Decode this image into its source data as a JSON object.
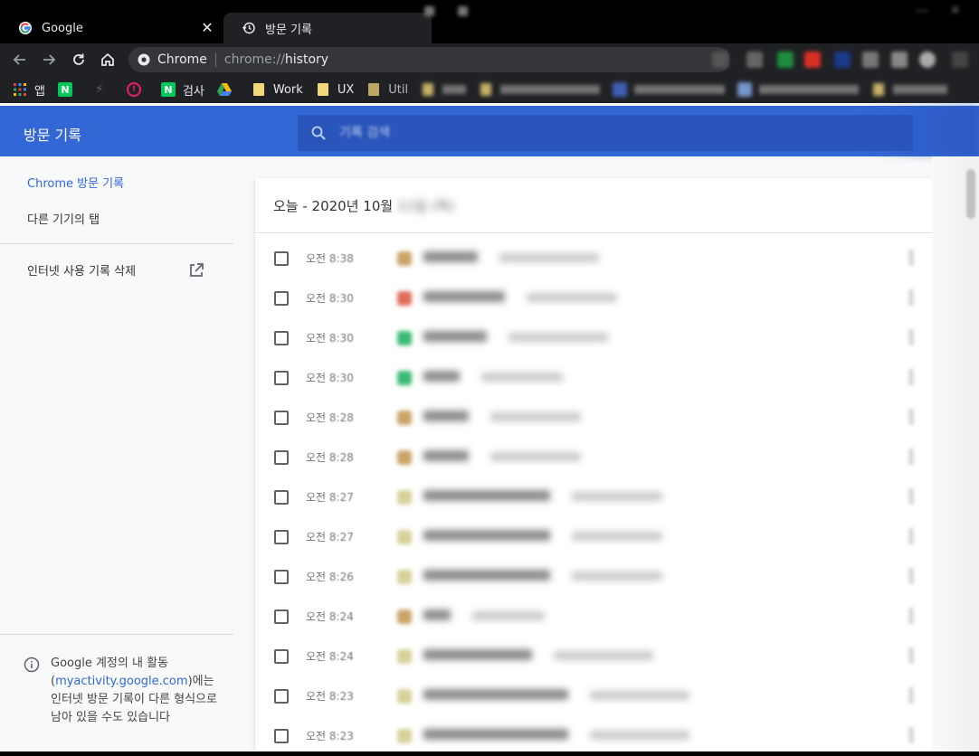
{
  "tabs": [
    {
      "title": "Google",
      "icon": "google-g-icon"
    },
    {
      "title": "방문 기록",
      "icon": "history-icon"
    }
  ],
  "omnibox": {
    "chip": "Chrome",
    "scheme": "chrome://",
    "host": "history"
  },
  "bookmarks": [
    {
      "label": "앱",
      "icon": "apps-grid-icon"
    },
    {
      "label": "",
      "icon": "naver-icon"
    },
    {
      "label": "",
      "icon": "bolt-icon"
    },
    {
      "label": "",
      "icon": "info-pink-icon"
    },
    {
      "label": "검사",
      "icon": "naver-icon"
    },
    {
      "label": "",
      "icon": "drive-icon"
    },
    {
      "label": "Work",
      "icon": "folder-icon"
    },
    {
      "label": "UX",
      "icon": "folder-icon"
    },
    {
      "label": "Util",
      "icon": "folder-icon"
    }
  ],
  "appbar": {
    "title": "방문 기록",
    "search_placeholder": "기록 검색"
  },
  "sidebar": {
    "items": [
      {
        "label": "Chrome 방문 기록"
      },
      {
        "label": "다른 기기의 탭"
      },
      {
        "label": "인터넷 사용 기록 삭제"
      }
    ],
    "footer": {
      "line1": "Google 계정의 내 활동",
      "link": "myactivity.google.com",
      "rest": "에는 인터넷 방문 기록이 다른 형식으로 남아 있을 수도 있습니다"
    }
  },
  "card": {
    "header": "오늘 - 2020년 10월",
    "rows": [
      {
        "ampm": "오전",
        "time": "8:38",
        "fav": "#c9a56a"
      },
      {
        "ampm": "오전",
        "time": "8:30",
        "fav": "#e06c5a"
      },
      {
        "ampm": "오전",
        "time": "8:30",
        "fav": "#3cba74"
      },
      {
        "ampm": "오전",
        "time": "8:30",
        "fav": "#3cba74"
      },
      {
        "ampm": "오전",
        "time": "8:28",
        "fav": "#c9a56a"
      },
      {
        "ampm": "오전",
        "time": "8:28",
        "fav": "#c9a56a"
      },
      {
        "ampm": "오전",
        "time": "8:27",
        "fav": "#d8d29a"
      },
      {
        "ampm": "오전",
        "time": "8:27",
        "fav": "#d8d29a"
      },
      {
        "ampm": "오전",
        "time": "8:26",
        "fav": "#d8d29a"
      },
      {
        "ampm": "오전",
        "time": "8:24",
        "fav": "#c9a56a"
      },
      {
        "ampm": "오전",
        "time": "8:24",
        "fav": "#d8d29a"
      },
      {
        "ampm": "오전",
        "time": "8:23",
        "fav": "#d8d29a"
      },
      {
        "ampm": "오전",
        "time": "8:23",
        "fav": "#d8d29a"
      }
    ]
  },
  "colors": {
    "accent": "#3367d6",
    "chrome_dark": "#202124"
  }
}
